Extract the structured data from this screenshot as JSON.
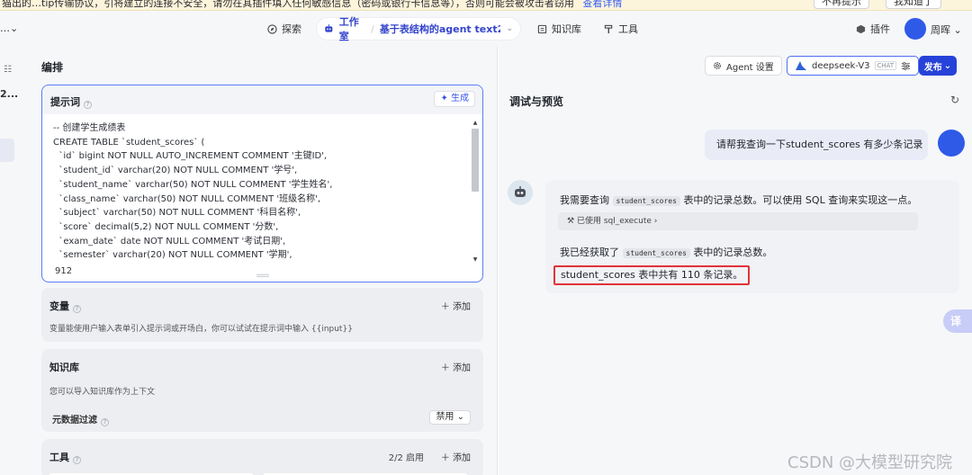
{
  "notice": {
    "text": "猫出的…tip传输协议，引将建立的连接不安全，请勿在其插件填入任何敏感信息（密码或银行卡信息等），否则可能会被攻击者窃用",
    "link": "查看详情",
    "btn1": "不再提示",
    "btn2": "我知道了"
  },
  "nav": {
    "explore": "探索",
    "workspace": "工作室",
    "agent_name": "基于表结构的agent text2...",
    "knowledge": "知识库",
    "tools": "工具",
    "plugins": "插件",
    "user_name": "周晖"
  },
  "sidebar": {
    "label": "2..."
  },
  "editor": {
    "title": "编排",
    "prompt": {
      "title": "提示词",
      "gen_label": "生成",
      "code": "-- 创建学生成绩表\nCREATE TABLE `student_scores` (\n  `id` bigint NOT NULL AUTO_INCREMENT COMMENT '主键ID',\n  `student_id` varchar(20) NOT NULL COMMENT '学号',\n  `student_name` varchar(50) NOT NULL COMMENT '学生姓名',\n  `class_name` varchar(50) NOT NULL COMMENT '班级名称',\n  `subject` varchar(50) NOT NULL COMMENT '科目名称',\n  `score` decimal(5,2) NOT NULL COMMENT '分数',\n  `exam_date` date NOT NULL COMMENT '考试日期',\n  `semester` varchar(20) NOT NULL COMMENT '学期',",
      "char_count": "912"
    },
    "variables": {
      "title": "变量",
      "add": "添加",
      "desc": "变量能使用户输入表单引入提示词或开场白，你可以试试在提示词中输入 {{input}}"
    },
    "knowledge": {
      "title": "知识库",
      "add": "添加",
      "desc": "您可以导入知识库作为上下文",
      "meta_filter": "元数据过滤",
      "meta_state": "禁用"
    },
    "tools": {
      "title": "工具",
      "enabled": "2/2 启用",
      "add": "添加"
    }
  },
  "preview": {
    "agent_settings": "Agent 设置",
    "model_name": "deepseek-V3",
    "model_tag": "CHAT",
    "publish": "发布",
    "title": "调试与预览",
    "user_message": "请帮我查询一下student_scores 有多少条记录",
    "bot": {
      "line1_pre": "我需要查询",
      "line1_code": "student_scores",
      "line1_post": "表中的记录总数。可以使用 SQL 查询来实现这一点。",
      "tool_used": "已使用 sql_execute",
      "line2_pre": "我已经获取了",
      "line2_code": "student_scores",
      "line2_post": "表中的记录总数。",
      "answer": "student_scores 表中共有 110 条记录。"
    },
    "translate": "译"
  },
  "watermark": "CSDN @大模型研究院"
}
